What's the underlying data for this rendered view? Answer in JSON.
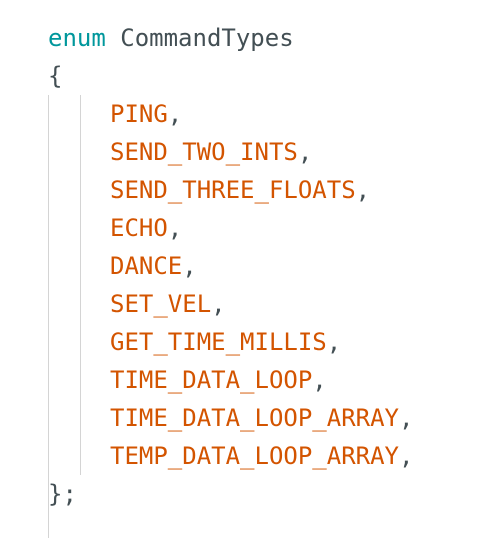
{
  "code": {
    "keyword": "enum",
    "type_name": "CommandTypes",
    "open_brace": "{",
    "close_brace": "};",
    "separator": ",",
    "members": [
      "PING",
      "SEND_TWO_INTS",
      "SEND_THREE_FLOATS",
      "ECHO",
      "DANCE",
      "SET_VEL",
      "GET_TIME_MILLIS",
      "TIME_DATA_LOOP",
      "TIME_DATA_LOOP_ARRAY",
      "TEMP_DATA_LOOP_ARRAY"
    ]
  },
  "colors": {
    "keyword": "#00979c",
    "identifier": "#434f54",
    "enum_value": "#d35400",
    "indent_guide": "#d4d4d4"
  }
}
